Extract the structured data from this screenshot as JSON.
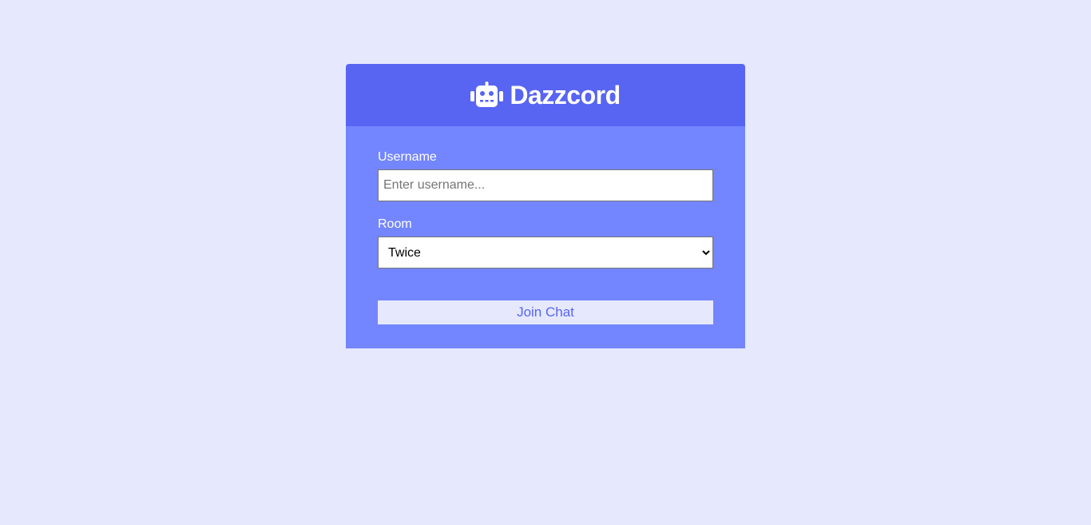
{
  "header": {
    "title": "Dazzcord",
    "icon": "robot-icon"
  },
  "form": {
    "username": {
      "label": "Username",
      "placeholder": "Enter username...",
      "value": ""
    },
    "room": {
      "label": "Room",
      "selected": "Twice"
    },
    "submit_label": "Join Chat"
  },
  "colors": {
    "background": "#e6e8fe",
    "header": "#5865f2",
    "panel": "#7386ff",
    "button_text": "#5865f2"
  }
}
